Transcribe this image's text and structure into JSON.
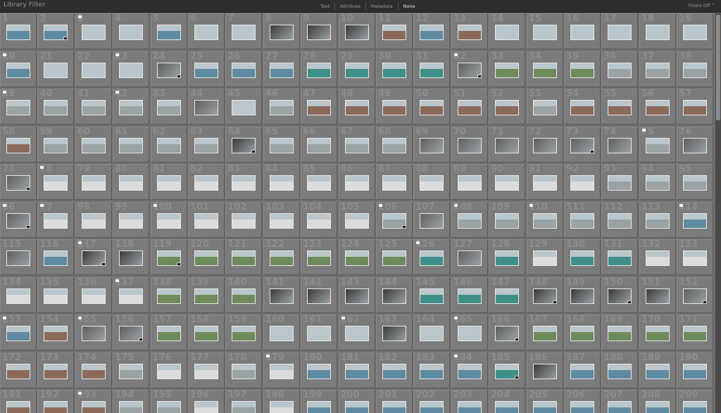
{
  "filter_bar": {
    "title": "Library Filter",
    "modes": [
      {
        "label": "Text",
        "active": false
      },
      {
        "label": "Attribute",
        "active": false
      },
      {
        "label": "Metadata",
        "active": false
      },
      {
        "label": "None",
        "active": true
      }
    ],
    "preset_label": "Filters Off ⌃"
  },
  "grid": {
    "columns": 19,
    "first_number": 1,
    "last_visible_number": 209,
    "flagged_numbers": [
      3,
      20,
      23,
      32,
      39,
      42,
      75,
      78,
      96,
      97,
      100,
      106,
      108,
      110,
      114,
      117,
      126,
      137,
      153,
      155,
      162,
      165,
      179,
      184,
      193
    ],
    "stacked_numbers": [
      2,
      24,
      32,
      64,
      73,
      77,
      96,
      106,
      117,
      119,
      148,
      150,
      152,
      156,
      166,
      185
    ]
  },
  "thumb_palette": {
    "sea": "#5f8ba0",
    "sky": "#b9c6cc",
    "dark": "#3a3a3a",
    "rock": "#8b6a5a",
    "grey": "#9aa2a4",
    "white": "#dcdcdc",
    "teal": "#3e8f88",
    "green": "#6f8a5a",
    "bw": "#606060"
  },
  "thumb_colors": [
    "sea",
    "sea",
    "sky",
    "sky",
    "sea",
    "sky",
    "sky",
    "dark",
    "dark",
    "dark",
    "rock",
    "sea",
    "rock",
    "sky",
    "sky",
    "sky",
    "sky",
    "sky",
    "sky",
    "sea",
    "sky",
    "sky",
    "sky",
    "bw",
    "sea",
    "sea",
    "sea",
    "teal",
    "teal",
    "teal",
    "teal",
    "bw",
    "green",
    "green",
    "green",
    "grey",
    "grey",
    "grey",
    "grey",
    "grey",
    "grey",
    "grey",
    "grey",
    "bw",
    "sky",
    "grey",
    "rock",
    "rock",
    "rock",
    "rock",
    "rock",
    "rock",
    "grey",
    "rock",
    "rock",
    "rock",
    "rock",
    "rock",
    "grey",
    "grey",
    "grey",
    "grey",
    "grey",
    "dark",
    "grey",
    "grey",
    "grey",
    "grey",
    "bw",
    "bw",
    "bw",
    "bw",
    "bw",
    "bw",
    "grey",
    "bw",
    "bw",
    "white",
    "white",
    "white",
    "white",
    "white",
    "white",
    "white",
    "white",
    "white",
    "white",
    "white",
    "white",
    "white",
    "white",
    "white",
    "grey",
    "grey",
    "grey",
    "bw",
    "white",
    "white",
    "white",
    "white",
    "white",
    "white",
    "white",
    "white",
    "white",
    "grey",
    "bw",
    "grey",
    "grey",
    "grey",
    "grey",
    "grey",
    "grey",
    "sea",
    "bw",
    "sea",
    "dark",
    "dark",
    "green",
    "green",
    "green",
    "green",
    "green",
    "green",
    "green",
    "teal",
    "bw",
    "teal",
    "white",
    "teal",
    "teal",
    "white",
    "white",
    "white",
    "white",
    "white",
    "white",
    "green",
    "green",
    "green",
    "dark",
    "dark",
    "dark",
    "dark",
    "teal",
    "teal",
    "teal",
    "dark",
    "dark",
    "dark",
    "dark",
    "bw",
    "sea",
    "rock",
    "bw",
    "bw",
    "green",
    "green",
    "green",
    "sky",
    "sky",
    "sky",
    "dark",
    "sky",
    "sky",
    "bw",
    "green",
    "green",
    "green",
    "green",
    "green",
    "rock",
    "rock",
    "rock",
    "grey",
    "white",
    "white",
    "grey",
    "white",
    "sea",
    "sea",
    "sea",
    "sea",
    "sea",
    "teal",
    "dark",
    "sea",
    "sea",
    "sea",
    "sea",
    "rock",
    "rock",
    "rock",
    "grey",
    "grey",
    "white",
    "grey",
    "white",
    "sea",
    "sea",
    "sea",
    "sea",
    "sea",
    "sea",
    "sea",
    "sea",
    "sea",
    "sea",
    "sea"
  ]
}
